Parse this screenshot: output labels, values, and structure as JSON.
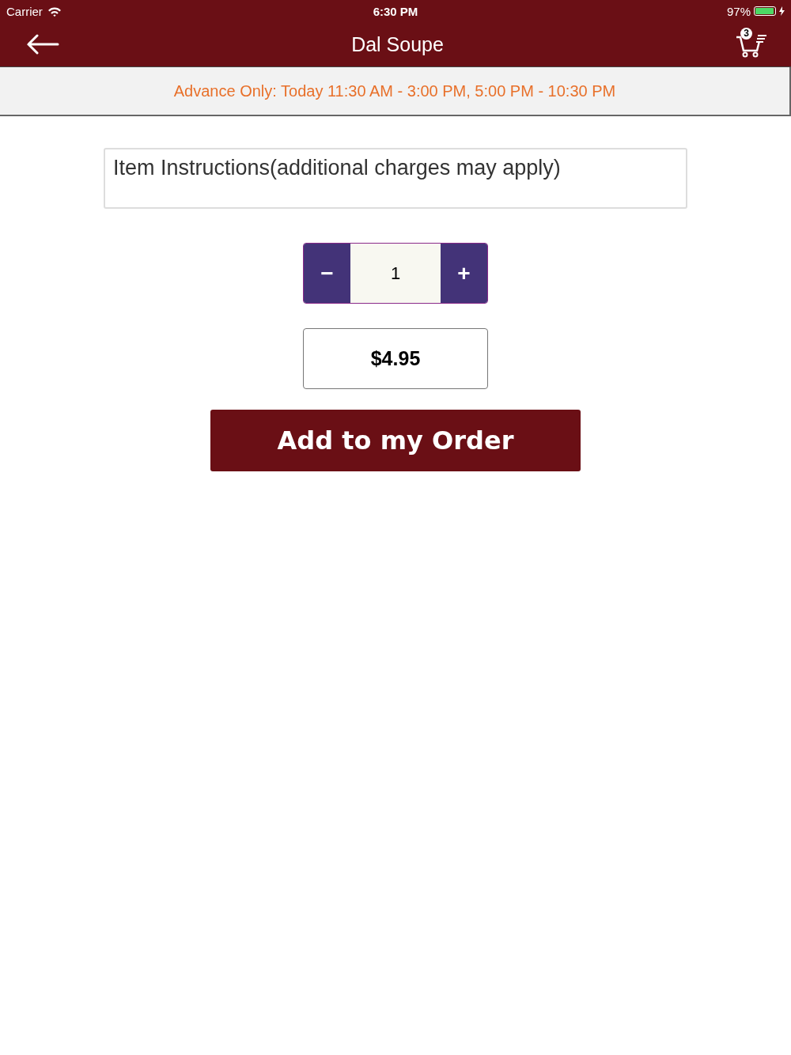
{
  "status_bar": {
    "carrier": "Carrier",
    "time": "6:30 PM",
    "battery": "97%"
  },
  "nav_bar": {
    "title": "Dal Soupe",
    "cart_count": "3"
  },
  "banner": {
    "text": "Advance Only: Today 11:30 AM - 3:00 PM, 5:00 PM - 10:30 PM"
  },
  "instructions": {
    "placeholder": "Item Instructions(additional charges may apply)"
  },
  "quantity": {
    "decrease": "−",
    "value": "1",
    "increase": "+"
  },
  "price": "$4.95",
  "add_button": "Add to my Order"
}
